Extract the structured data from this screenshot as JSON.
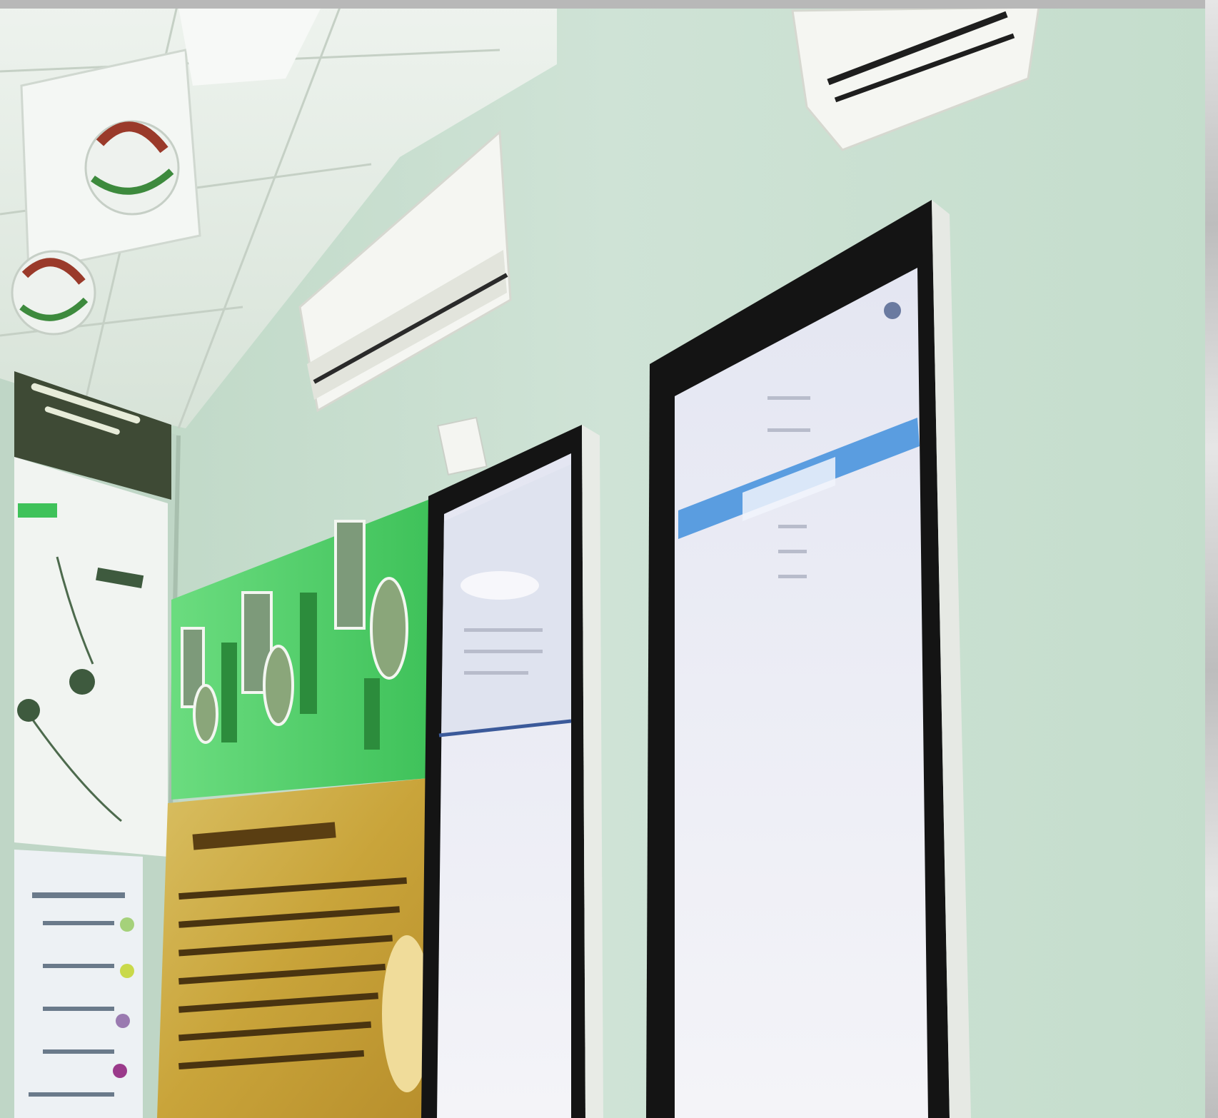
{
  "scene": {
    "description_labels": {
      "poster_headline": "",
      "left_banner": "",
      "kiosk_right_screen_title": ""
    },
    "colors": {
      "wall": "#cfe3d6",
      "ceiling": "#e9efe9",
      "kiosk_frame": "#1a1a1a",
      "kiosk_screen": "#eef0f7",
      "screen_accent_bar": "#5a9de0",
      "poster_green": "#3fc25a",
      "poster_gold": "#c9a43a",
      "banner_dark": "#3e4a35"
    }
  }
}
